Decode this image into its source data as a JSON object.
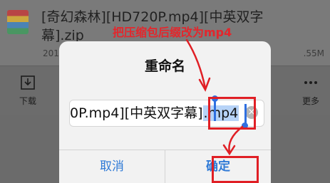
{
  "file": {
    "name_line1": "[奇幻森林][HD720P.mp4][中英双字",
    "name_line2": "幕].zip",
    "meta_left": "201",
    "meta_right": ".55M"
  },
  "toolbar": {
    "download_label": "下载",
    "more_label": "更多"
  },
  "dialog": {
    "title": "重命名",
    "input_text_before": "0P.mp4][中英双字幕]",
    "input_text_selected": ".mp4",
    "cancel_label": "取消",
    "confirm_label": "确定"
  },
  "annotation": {
    "text": "把压缩包后缀改为mp4",
    "color": "#e4262c"
  },
  "colors": {
    "button_blue": "#2f7ad6",
    "selection": "#b7d3f7",
    "cursor": "#2f6fe0"
  }
}
